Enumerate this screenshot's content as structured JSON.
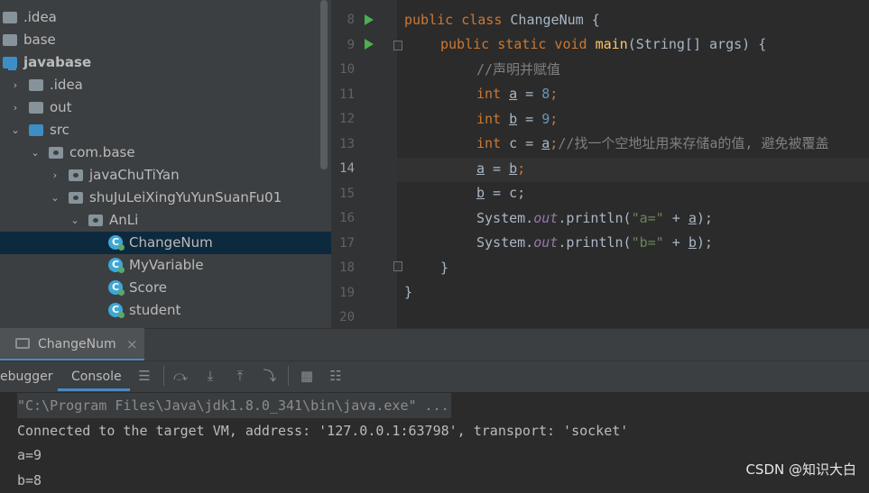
{
  "project_tree": {
    "items": [
      {
        "label": ".idea",
        "depth": 0,
        "icon": "folder-icon",
        "chevron": "",
        "selected": false
      },
      {
        "label": "base",
        "depth": 0,
        "icon": "folder-icon",
        "chevron": "",
        "selected": false
      },
      {
        "label": "javabase",
        "depth": 0,
        "icon": "module-icon",
        "chevron": "",
        "selected": false
      },
      {
        "label": ".idea",
        "depth": 1,
        "icon": "folder-icon",
        "chevron": "›",
        "selected": false
      },
      {
        "label": "out",
        "depth": 1,
        "icon": "folder-icon",
        "chevron": "›",
        "selected": false
      },
      {
        "label": "src",
        "depth": 1,
        "icon": "source-folder-icon",
        "chevron": "⌄",
        "selected": false
      },
      {
        "label": "com.base",
        "depth": 2,
        "icon": "package-icon",
        "chevron": "⌄",
        "selected": false
      },
      {
        "label": "javaChuTiYan",
        "depth": 3,
        "icon": "package-icon",
        "chevron": "›",
        "selected": false
      },
      {
        "label": "shuJuLeiXingYuYunSuanFu01",
        "depth": 3,
        "icon": "package-icon",
        "chevron": "⌄",
        "selected": false
      },
      {
        "label": "AnLi",
        "depth": 4,
        "icon": "package-icon",
        "chevron": "⌄",
        "selected": false
      },
      {
        "label": "ChangeNum",
        "depth": 5,
        "icon": "class-icon",
        "chevron": "",
        "selected": true
      },
      {
        "label": "MyVariable",
        "depth": 5,
        "icon": "class-icon",
        "chevron": "",
        "selected": false
      },
      {
        "label": "Score",
        "depth": 5,
        "icon": "class-icon",
        "chevron": "",
        "selected": false
      },
      {
        "label": "student",
        "depth": 5,
        "icon": "class-icon",
        "chevron": "",
        "selected": false
      }
    ]
  },
  "editor": {
    "line_numbers": [
      "8",
      "9",
      "10",
      "11",
      "12",
      "13",
      "14",
      "15",
      "16",
      "17",
      "18",
      "19",
      "20"
    ],
    "current_line": "14",
    "lines": {
      "l8": {
        "kw": "public class ",
        "rest": "ChangeNum {"
      },
      "l9": {
        "kw": "public static void ",
        "fn": "main",
        "rest": "(String[] args) {"
      },
      "l10": {
        "comment": "//声明并赋值"
      },
      "l11": {
        "kw": "int ",
        "var": "a",
        "eq": " = ",
        "num": "8",
        "end": ";"
      },
      "l12": {
        "kw": "int ",
        "var": "b",
        "eq": " = ",
        "num": "9",
        "end": ";"
      },
      "l13": {
        "kw": "int ",
        "pre": "c = ",
        "var": "a",
        "end": ";",
        "comment": "//找一个空地址用来存储a的值, 避免被覆盖"
      },
      "l14": {
        "var1": "a",
        "eq": " = ",
        "var2": "b",
        "end": ";"
      },
      "l15": {
        "var": "b",
        "rest": " = c;"
      },
      "l16": {
        "pre": "System.",
        "field": "out",
        "mid": ".println(",
        "str": "\"a=\"",
        "plus": " + ",
        "var": "a",
        "end": ");"
      },
      "l17": {
        "pre": "System.",
        "field": "out",
        "mid": ".println(",
        "str": "\"b=\"",
        "plus": " + ",
        "var": "b",
        "end": ");"
      },
      "l18": {
        "rest": "}"
      },
      "l19": {
        "rest": "}"
      }
    }
  },
  "run_panel": {
    "tab_label": "ChangeNum",
    "close_glyph": "×",
    "toolbar": {
      "debugger_label": "ebugger",
      "console_label": "Console"
    },
    "console_lines": [
      "\"C:\\Program Files\\Java\\jdk1.8.0_341\\bin\\java.exe\" ...",
      "Connected to the target VM, address: '127.0.0.1:63798', transport: 'socket'",
      "a=9",
      "b=8"
    ]
  },
  "watermark": "CSDN @知识大白",
  "colors": {
    "keyword": "#cc7832",
    "number": "#6897bb",
    "string": "#6a8759",
    "comment": "#808080",
    "method": "#ffc66d",
    "field": "#9876aa",
    "selection": "#0d293e",
    "accent": "#4a88c7"
  }
}
